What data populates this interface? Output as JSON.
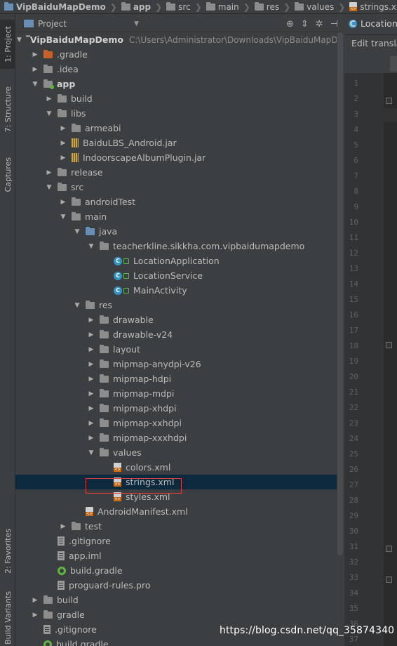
{
  "breadcrumb": [
    {
      "label": "VipBaiduMapDemo",
      "icon": "folder-icon",
      "bold": true
    },
    {
      "label": "app",
      "icon": "folder-icon",
      "bold": true
    },
    {
      "label": "src",
      "icon": "folder-icon",
      "bold": false
    },
    {
      "label": "main",
      "icon": "folder-icon",
      "bold": false
    },
    {
      "label": "res",
      "icon": "folder-icon",
      "bold": false
    },
    {
      "label": "values",
      "icon": "folder-icon",
      "bold": false
    },
    {
      "label": "strings.xml",
      "icon": "xml-file-icon",
      "bold": false
    }
  ],
  "side_tabs": {
    "project": "1: Project",
    "structure": "7: Structure",
    "captures": "Captures",
    "favorites": "2: Favorites",
    "build_variants": "Build Variants"
  },
  "panel": {
    "title": "Project"
  },
  "tree": [
    {
      "label": "VipBaiduMapDemo",
      "path": "C:\\Users\\Administrator\\Downloads\\VipBaiduMapDemo",
      "icon": "folder-icon",
      "arrow": "down",
      "depth": 0,
      "bold": true
    },
    {
      "label": ".gradle",
      "icon": "folder-orange-icon",
      "arrow": "right",
      "depth": 1
    },
    {
      "label": ".idea",
      "icon": "folder-icon",
      "arrow": "right",
      "depth": 1
    },
    {
      "label": "app",
      "icon": "module-folder-icon",
      "arrow": "down",
      "depth": 1,
      "bold": true
    },
    {
      "label": "build",
      "icon": "folder-icon",
      "arrow": "right",
      "depth": 2
    },
    {
      "label": "libs",
      "icon": "folder-icon",
      "arrow": "down",
      "depth": 2
    },
    {
      "label": "armeabi",
      "icon": "folder-icon",
      "arrow": "right",
      "depth": 3
    },
    {
      "label": "BaiduLBS_Android.jar",
      "icon": "jar-icon",
      "arrow": "right",
      "depth": 3
    },
    {
      "label": "IndoorscapeAlbumPlugin.jar",
      "icon": "jar-icon",
      "arrow": "right",
      "depth": 3
    },
    {
      "label": "release",
      "icon": "folder-icon",
      "arrow": "right",
      "depth": 2
    },
    {
      "label": "src",
      "icon": "folder-icon",
      "arrow": "down",
      "depth": 2
    },
    {
      "label": "androidTest",
      "icon": "folder-icon",
      "arrow": "right",
      "depth": 3
    },
    {
      "label": "main",
      "icon": "folder-icon",
      "arrow": "down",
      "depth": 3
    },
    {
      "label": "java",
      "icon": "source-folder-icon",
      "arrow": "down",
      "depth": 4
    },
    {
      "label": "teacherkline.sikkha.com.vipbaidumapdemo",
      "icon": "package-icon",
      "arrow": "down",
      "depth": 5
    },
    {
      "label": "LocationApplication",
      "icon": "class-icon",
      "arrow": "none",
      "depth": 7
    },
    {
      "label": "LocationService",
      "icon": "class-icon",
      "arrow": "none",
      "depth": 7
    },
    {
      "label": "MainActivity",
      "icon": "class-icon",
      "arrow": "none",
      "depth": 7
    },
    {
      "label": "res",
      "icon": "resource-folder-icon",
      "arrow": "down",
      "depth": 4
    },
    {
      "label": "drawable",
      "icon": "folder-icon",
      "arrow": "right",
      "depth": 5
    },
    {
      "label": "drawable-v24",
      "icon": "folder-icon",
      "arrow": "right",
      "depth": 5
    },
    {
      "label": "layout",
      "icon": "folder-icon",
      "arrow": "right",
      "depth": 5
    },
    {
      "label": "mipmap-anydpi-v26",
      "icon": "folder-icon",
      "arrow": "right",
      "depth": 5
    },
    {
      "label": "mipmap-hdpi",
      "icon": "folder-icon",
      "arrow": "right",
      "depth": 5
    },
    {
      "label": "mipmap-mdpi",
      "icon": "folder-icon",
      "arrow": "right",
      "depth": 5
    },
    {
      "label": "mipmap-xhdpi",
      "icon": "folder-icon",
      "arrow": "right",
      "depth": 5
    },
    {
      "label": "mipmap-xxhdpi",
      "icon": "folder-icon",
      "arrow": "right",
      "depth": 5
    },
    {
      "label": "mipmap-xxxhdpi",
      "icon": "folder-icon",
      "arrow": "right",
      "depth": 5
    },
    {
      "label": "values",
      "icon": "folder-icon",
      "arrow": "down",
      "depth": 5
    },
    {
      "label": "colors.xml",
      "icon": "xml-file-icon",
      "arrow": "none",
      "depth": 7
    },
    {
      "label": "strings.xml",
      "icon": "xml-file-icon",
      "arrow": "none",
      "depth": 7,
      "selected": true
    },
    {
      "label": "styles.xml",
      "icon": "xml-file-icon",
      "arrow": "none",
      "depth": 7
    },
    {
      "label": "AndroidManifest.xml",
      "icon": "manifest-icon",
      "arrow": "none",
      "depth": 5
    },
    {
      "label": "test",
      "icon": "folder-icon",
      "arrow": "right",
      "depth": 3
    },
    {
      "label": ".gitignore",
      "icon": "text-file-icon",
      "arrow": "none",
      "depth": 3
    },
    {
      "label": "app.iml",
      "icon": "text-file-icon",
      "arrow": "none",
      "depth": 3
    },
    {
      "label": "build.gradle",
      "icon": "gradle-icon",
      "arrow": "none",
      "depth": 3
    },
    {
      "label": "proguard-rules.pro",
      "icon": "text-file-icon",
      "arrow": "none",
      "depth": 3
    },
    {
      "label": "build",
      "icon": "folder-icon",
      "arrow": "right",
      "depth": 1
    },
    {
      "label": "gradle",
      "icon": "folder-icon",
      "arrow": "right",
      "depth": 1
    },
    {
      "label": ".gitignore",
      "icon": "text-file-icon",
      "arrow": "none",
      "depth": 2
    },
    {
      "label": "build.gradle",
      "icon": "gradle-icon",
      "arrow": "none",
      "depth": 2
    }
  ],
  "editor": {
    "tab_label": "LocationService",
    "translation_bar": "Edit translations",
    "line_numbers": [
      "1",
      "2",
      "3",
      "4",
      "5",
      "6",
      "7",
      "8",
      "9",
      "10",
      "11",
      "12",
      "13",
      "14",
      "15",
      "16",
      "17",
      "18",
      "19",
      "20",
      "21",
      "22",
      "23",
      "24",
      "25",
      "26",
      "27",
      "28",
      "29",
      "30",
      "31",
      "32",
      "33",
      "34",
      "35",
      "36",
      "37"
    ]
  },
  "watermark": "https://blog.csdn.net/qq_35874340",
  "colors": {
    "background": "#3c3f41",
    "selection": "#0d293e",
    "highlight_box": "#e04040",
    "class_icon": "#3592c4"
  }
}
